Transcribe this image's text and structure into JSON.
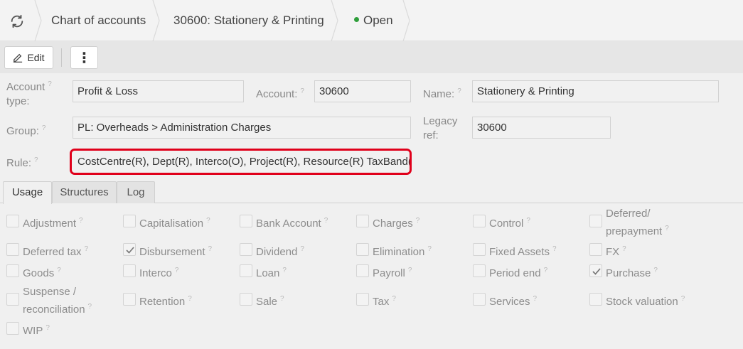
{
  "breadcrumb": {
    "items": [
      "Chart of accounts",
      "30600: Stationery & Printing"
    ],
    "status": "Open"
  },
  "toolbar": {
    "edit_label": "Edit",
    "more_label": "⋮"
  },
  "form": {
    "account_type": {
      "label_line1": "Account",
      "label_line2": "type:",
      "value": "Profit & Loss"
    },
    "account": {
      "label": "Account:",
      "value": "30600"
    },
    "name": {
      "label": "Name:",
      "value": "Stationery & Printing"
    },
    "group": {
      "label": "Group:",
      "value": "PL: Overheads > Administration Charges"
    },
    "legacy_ref": {
      "label_line1": "Legacy",
      "label_line2": "ref:",
      "value": "30600"
    },
    "rule": {
      "label": "Rule:",
      "value": "CostCentre(R), Dept(R), Interco(O), Project(R), Resource(R) TaxBand(..."
    },
    "help_mark": "?"
  },
  "tabs": [
    "Usage",
    "Structures",
    "Log"
  ],
  "usage": {
    "items": [
      {
        "label": "Adjustment",
        "checked": false
      },
      {
        "label": "Capitalisation",
        "checked": false
      },
      {
        "label": "Bank Account",
        "checked": false
      },
      {
        "label": "Charges",
        "checked": false
      },
      {
        "label": "Control",
        "checked": false
      },
      {
        "label_line1": "Deferred/",
        "label_line2": "prepayment",
        "checked": false
      },
      {
        "label": "Deferred tax",
        "checked": false
      },
      {
        "label": "Disbursement",
        "checked": true
      },
      {
        "label": "Dividend",
        "checked": false
      },
      {
        "label": "Elimination",
        "checked": false
      },
      {
        "label": "Fixed Assets",
        "checked": false
      },
      {
        "label": "FX",
        "checked": false
      },
      {
        "label": "Goods",
        "checked": false
      },
      {
        "label": "Interco",
        "checked": false
      },
      {
        "label": "Loan",
        "checked": false
      },
      {
        "label": "Payroll",
        "checked": false
      },
      {
        "label": "Period end",
        "checked": false
      },
      {
        "label": "Purchase",
        "checked": true
      },
      {
        "label_line1": "Suspense /",
        "label_line2": "reconciliation",
        "checked": false
      },
      {
        "label": "Retention",
        "checked": false
      },
      {
        "label": "Sale",
        "checked": false
      },
      {
        "label": "Tax",
        "checked": false
      },
      {
        "label": "Services",
        "checked": false
      },
      {
        "label": "Stock valuation",
        "checked": false
      },
      {
        "label": "WIP",
        "checked": false
      }
    ]
  }
}
